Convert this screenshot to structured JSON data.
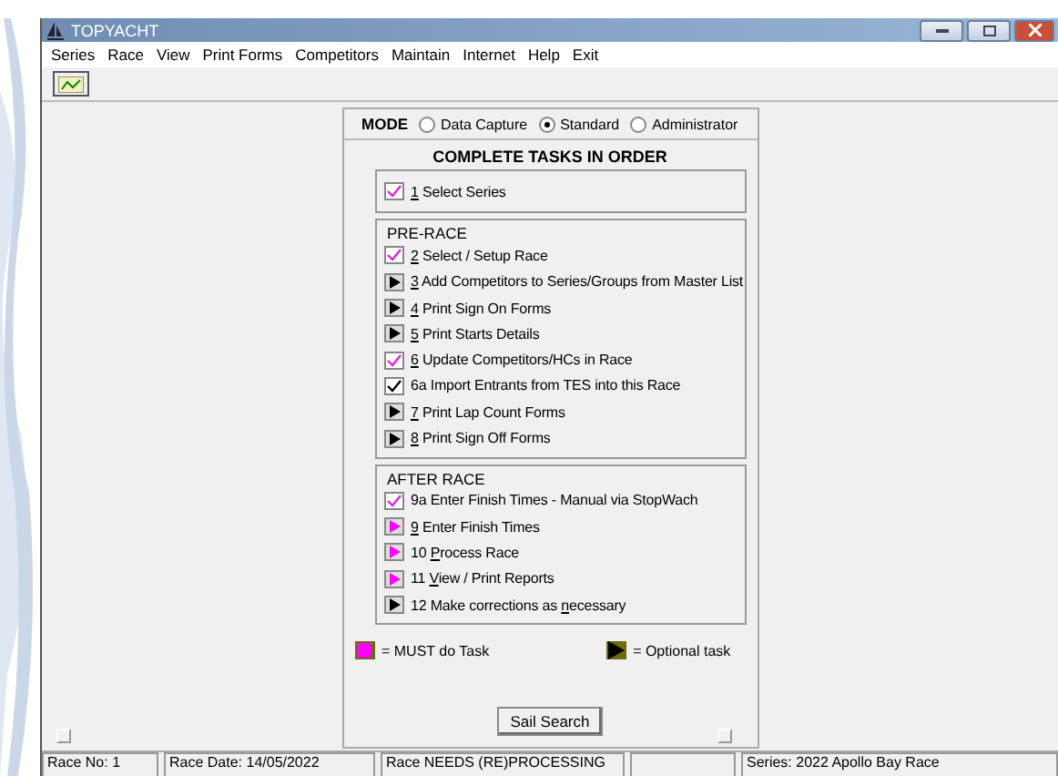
{
  "window": {
    "title": "TOPYACHT"
  },
  "menu": [
    "Series",
    "Race",
    "View",
    "Print Forms",
    "Competitors",
    "Maintain",
    "Internet",
    "Help",
    "Exit"
  ],
  "mode": {
    "label": "MODE",
    "options": [
      {
        "label": "Data Capture",
        "selected": false
      },
      {
        "label": "Standard",
        "selected": true
      },
      {
        "label": "Administrator",
        "selected": false
      }
    ]
  },
  "heading": "COMPLETE TASKS IN ORDER",
  "first_task": {
    "kind": "done",
    "key": "1",
    "post": " Select Series"
  },
  "sections": [
    {
      "title": "PRE-RACE",
      "tasks": [
        {
          "kind": "done",
          "key": "2",
          "post": " Select  / Setup Race"
        },
        {
          "kind": "optional",
          "key": "3",
          "post": " Add Competitors to Series/Groups from Master List"
        },
        {
          "kind": "optional",
          "key": "4",
          "post": " Print Sign On Forms"
        },
        {
          "kind": "optional",
          "key": "5",
          "post": " Print Starts Details"
        },
        {
          "kind": "done",
          "key": "6",
          "post": " Update Competitors/HCs in Race"
        },
        {
          "kind": "ticked",
          "pre": "6a Import Entrants from TES into this Race"
        },
        {
          "kind": "optional",
          "key": "7",
          "post": " Print Lap Count Forms"
        },
        {
          "kind": "optional",
          "key": "8",
          "post": " Print Sign Off Forms"
        }
      ]
    },
    {
      "title": "AFTER RACE",
      "tasks": [
        {
          "kind": "done",
          "pre": "9a Enter Finish Times - Manual via StopWach"
        },
        {
          "kind": "must",
          "key": "9",
          "post": " Enter Finish Times"
        },
        {
          "kind": "must",
          "pre": "10 ",
          "key": "P",
          "post": "rocess Race"
        },
        {
          "kind": "must",
          "pre": "11 ",
          "key": "V",
          "post": "iew / Print Reports"
        },
        {
          "kind": "optional",
          "pre": "12 Make corrections as ",
          "key": "n",
          "post": "ecessary"
        }
      ]
    }
  ],
  "legend": [
    {
      "kind": "must",
      "label": "= MUST do Task"
    },
    {
      "kind": "optional",
      "label": "= Optional task"
    }
  ],
  "button": "Sail Search",
  "status_bar": [
    "Race No: 1",
    "Race Date: 14/05/2022",
    "Race NEEDS (RE)PROCESSING",
    "Series: 2022 Apollo Bay Race"
  ]
}
